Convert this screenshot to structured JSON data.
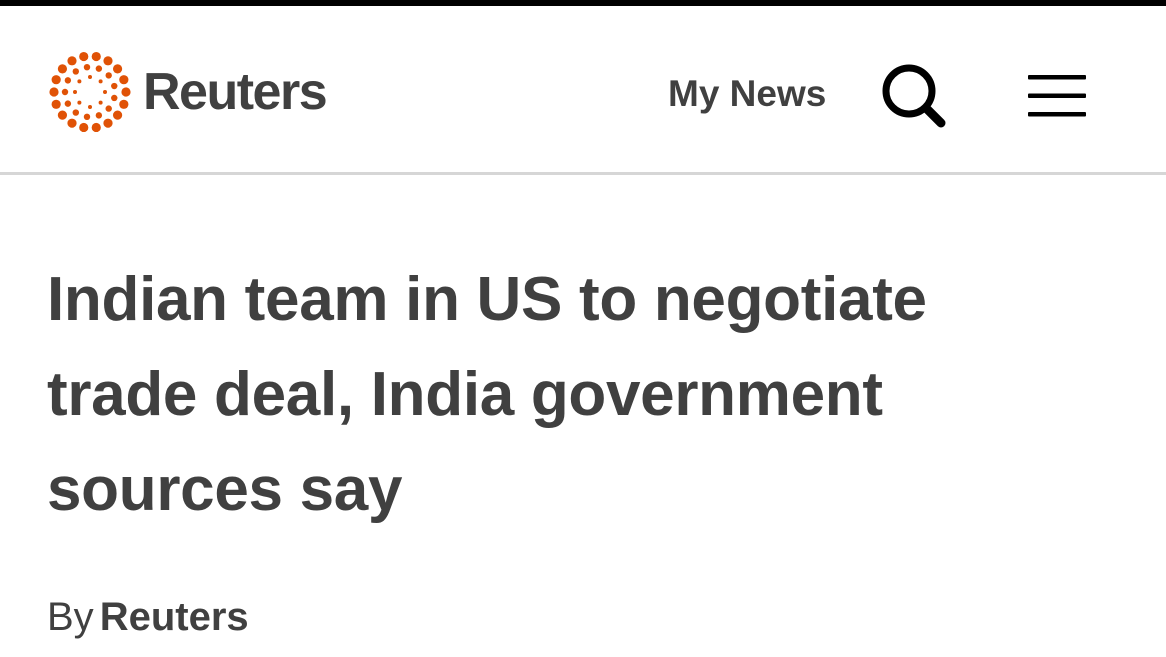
{
  "header": {
    "brand": "Reuters",
    "my_news_label": "My News",
    "search_icon": "search-icon",
    "menu_icon": "hamburger-menu-icon",
    "logo_color": "#e05206",
    "text_color": "#404040"
  },
  "article": {
    "headline": "Indian team in US to negotiate trade deal, India government sources say",
    "byline_prefix": "By",
    "byline_author": "Reuters"
  }
}
